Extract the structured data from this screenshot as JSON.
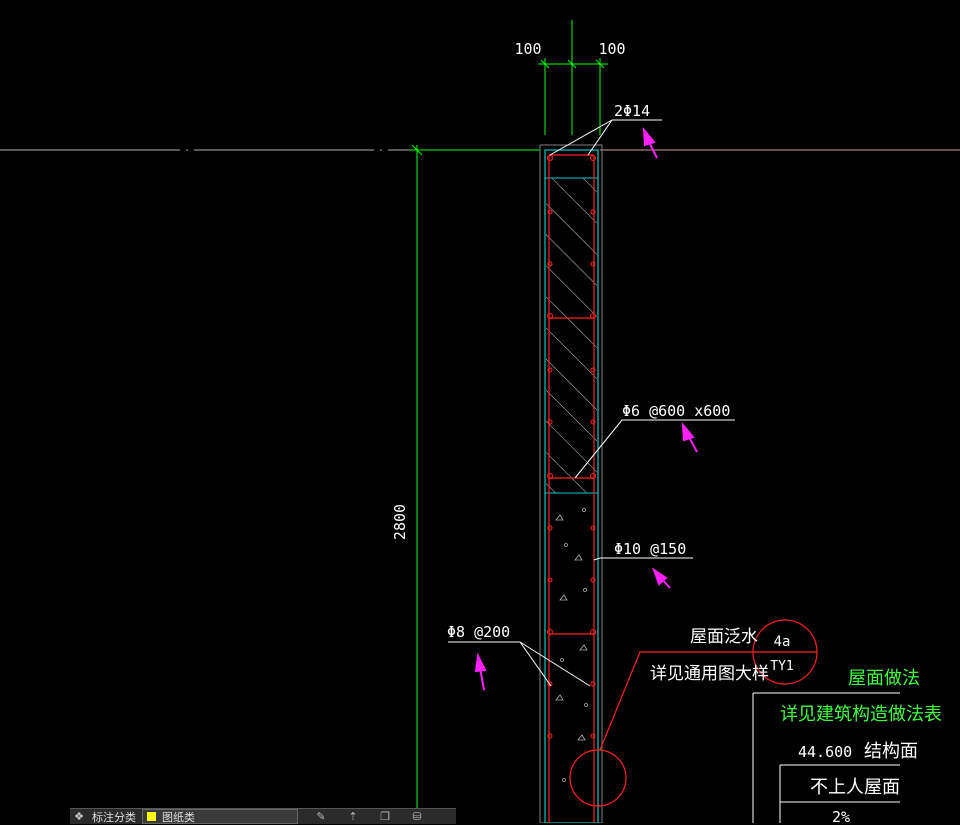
{
  "drawing": {
    "dim_top_left": "100",
    "dim_top_right": "100",
    "dim_height": "2800",
    "rebar_top": "2Φ14",
    "rebar_mesh": "Φ6 @600 x600",
    "rebar_vertical": "Φ10 @150",
    "rebar_horizontal": "Φ8 @200",
    "note_flashing": "屋面泛水",
    "note_detail": "详见通用图大样",
    "detail_no": "4a",
    "detail_sheet": "TY1",
    "roof_title": "屋面做法",
    "roof_note": "详见建筑构造做法表",
    "elevation": "44.600",
    "elevation_label": "结构面",
    "roof_type": "不上人屋面",
    "slope": "2%",
    "colors": {
      "wall": "#00c8c8",
      "rebar": "#ff2020",
      "dimension": "#00ff00",
      "leader": "#ffffff",
      "arrow_marker": "#ff20ff",
      "table_text": "#40ff40"
    }
  },
  "statusbar": {
    "label": "标注分类",
    "layer_name": "图纸类",
    "layer_color": "#ffff00"
  }
}
